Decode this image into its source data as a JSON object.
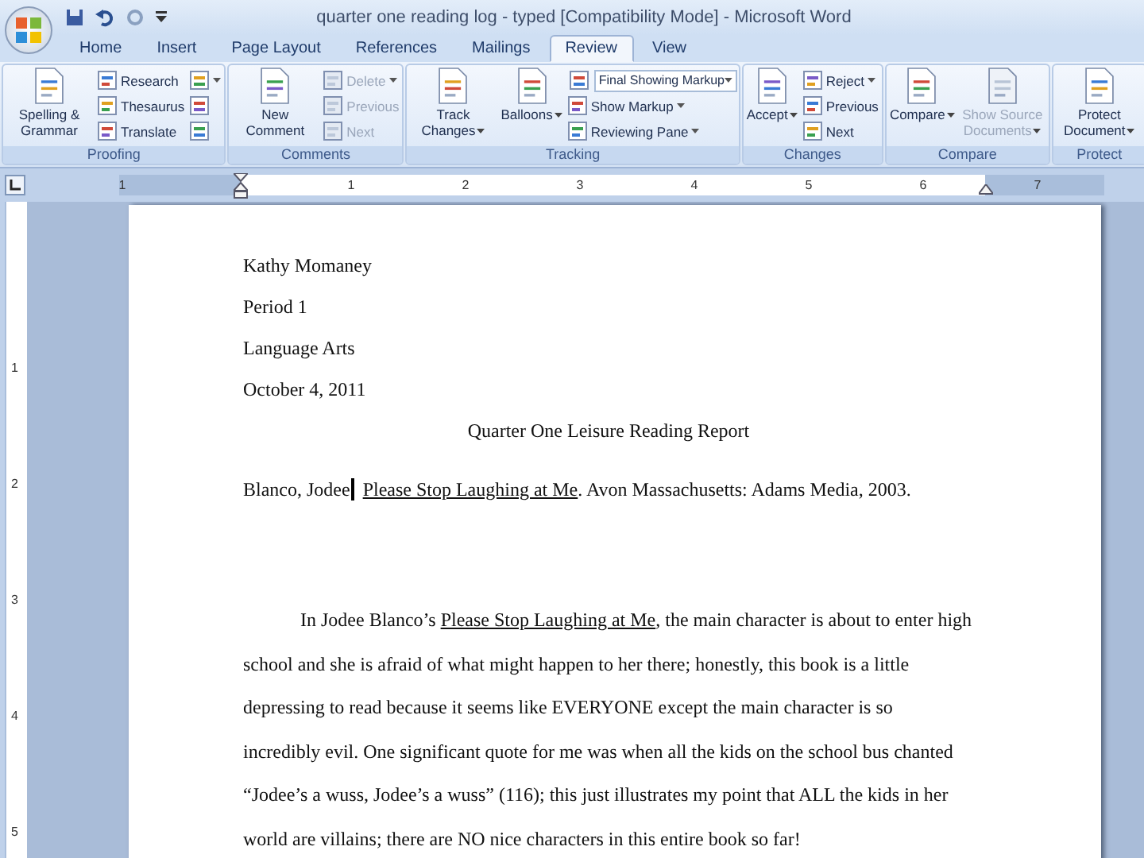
{
  "title_bar": {
    "title": "quarter one reading log - typed [Compatibility Mode] - Microsoft Word"
  },
  "tabs": [
    {
      "label": "Home",
      "selected": false
    },
    {
      "label": "Insert",
      "selected": false
    },
    {
      "label": "Page Layout",
      "selected": false
    },
    {
      "label": "References",
      "selected": false
    },
    {
      "label": "Mailings",
      "selected": false
    },
    {
      "label": "Review",
      "selected": true
    },
    {
      "label": "View",
      "selected": false
    }
  ],
  "ribbon": {
    "groups": [
      {
        "label": "Proofing",
        "items": [
          {
            "kind": "large",
            "label": "Spelling & Grammar",
            "disabled": false,
            "menu": false
          },
          {
            "kind": "stack",
            "items": [
              {
                "kind": "small",
                "label": "Research",
                "disabled": false,
                "menu": false
              },
              {
                "kind": "small",
                "label": "Thesaurus",
                "disabled": false,
                "menu": false
              },
              {
                "kind": "small",
                "label": "Translate",
                "disabled": false,
                "menu": false
              }
            ]
          },
          {
            "kind": "stack",
            "items": [
              {
                "kind": "icon",
                "disabled": false,
                "menu": true
              },
              {
                "kind": "icon",
                "disabled": false,
                "menu": false
              },
              {
                "kind": "icon",
                "disabled": false,
                "menu": false
              }
            ]
          }
        ]
      },
      {
        "label": "Comments",
        "items": [
          {
            "kind": "large",
            "label": "New Comment",
            "disabled": false,
            "menu": false
          },
          {
            "kind": "stack",
            "items": [
              {
                "kind": "small",
                "label": "Delete",
                "disabled": true,
                "menu": true
              },
              {
                "kind": "small",
                "label": "Previous",
                "disabled": true,
                "menu": false
              },
              {
                "kind": "small",
                "label": "Next",
                "disabled": true,
                "menu": false
              }
            ]
          }
        ]
      },
      {
        "label": "Tracking",
        "items": [
          {
            "kind": "large",
            "label": "Track Changes",
            "disabled": false,
            "menu": true
          },
          {
            "kind": "large",
            "label": "Balloons",
            "disabled": false,
            "menu": true
          },
          {
            "kind": "stack",
            "items": [
              {
                "kind": "select",
                "label": "Final Showing Markup",
                "disabled": false,
                "menu": true
              },
              {
                "kind": "small",
                "label": "Show Markup",
                "disabled": false,
                "menu": true
              },
              {
                "kind": "small",
                "label": "Reviewing Pane",
                "disabled": false,
                "menu": true
              }
            ]
          }
        ]
      },
      {
        "label": "Changes",
        "items": [
          {
            "kind": "large",
            "label": "Accept",
            "disabled": false,
            "menu": true
          },
          {
            "kind": "stack",
            "items": [
              {
                "kind": "small",
                "label": "Reject",
                "disabled": false,
                "menu": true
              },
              {
                "kind": "small",
                "label": "Previous",
                "disabled": false,
                "menu": false
              },
              {
                "kind": "small",
                "label": "Next",
                "disabled": false,
                "menu": false
              }
            ]
          }
        ]
      },
      {
        "label": "Compare",
        "items": [
          {
            "kind": "large",
            "label": "Compare",
            "disabled": false,
            "menu": true
          },
          {
            "kind": "large",
            "label": "Show Source Documents",
            "disabled": true,
            "menu": true
          }
        ]
      },
      {
        "label": "Protect",
        "items": [
          {
            "kind": "large",
            "label": "Protect Document",
            "disabled": false,
            "menu": true
          }
        ]
      }
    ]
  },
  "ruler": {
    "labels": [
      "1",
      "1",
      "2",
      "3",
      "4",
      "5",
      "6",
      "7"
    ]
  },
  "vertical_ruler": {
    "labels": [
      "1",
      "2",
      "3",
      "4",
      "5"
    ]
  },
  "document": {
    "header_lines": [
      "Kathy Momaney",
      "Period 1",
      "Language Arts",
      "October 4, 2011"
    ],
    "title": "Quarter One Leisure Reading Report",
    "citation": [
      {
        "text": "Blanco, Jodee",
        "underline": false,
        "cursor": true
      },
      {
        "text": "Please Stop Laughing at Me",
        "underline": true,
        "cursor": false
      },
      {
        "text": ".  Avon Massachusetts:  Adams Media, 2003.",
        "underline": false,
        "cursor": false
      }
    ],
    "paragraph": [
      {
        "text": "In Jodee Blanco’s ",
        "underline": false
      },
      {
        "text": "Please Stop Laughing at Me",
        "underline": true
      },
      {
        "text": ", the main character is about to enter high school and she is afraid of what might happen to her there; honestly, this book is a little depressing to read because it seems like EVERYONE except the main character is so incredibly evil.  One significant quote for me was when all the kids on the school bus chanted “Jodee’s a wuss, Jodee’s a wuss” (116); this just illustrates my point that ALL the kids in her world are villains; there are NO nice characters in this entire book so far!",
        "underline": false
      }
    ]
  }
}
